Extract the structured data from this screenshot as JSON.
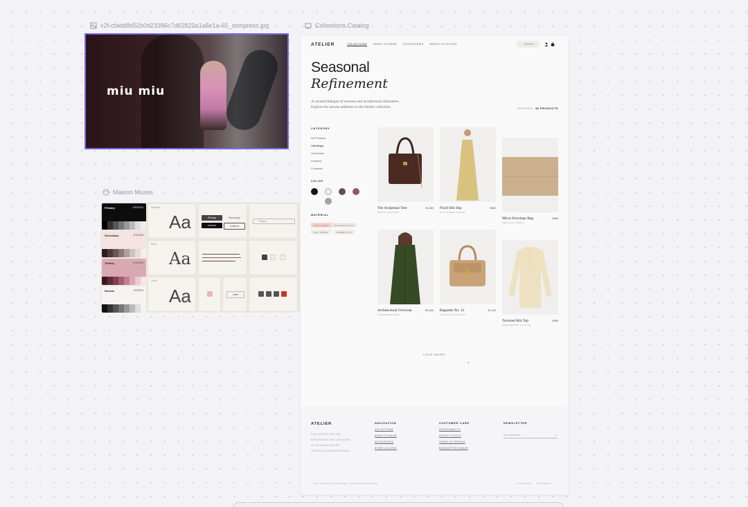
{
  "canvas": {
    "image_label": "v2f-cfadd8d52b0d23386c7d62823a1a5e1a-65_compress.jpg",
    "catalog_label": "Collections.Catalog",
    "muses_label": "Maison Muses"
  },
  "hero_image": {
    "logo_text": "miu miu"
  },
  "muses": {
    "swatches": [
      {
        "name": "Primary",
        "hex": "#0D0D0D",
        "color": "#0d0d0d",
        "ramp": [
          "#000",
          "#333",
          "#555",
          "#777",
          "#999",
          "#bbb",
          "#ddd",
          "#eee"
        ]
      },
      {
        "name": "Secondary",
        "hex": "#F5E6E8",
        "color": "#f3e4e0",
        "ramp": [
          "#2b1d1b",
          "#4e3936",
          "#6b5753",
          "#8d7a77",
          "#b09f9c",
          "#cfc1be",
          "#e5dbd8",
          "#f5efed"
        ]
      },
      {
        "name": "Tertiary",
        "hex": "#D4A5A5",
        "color": "#d9a9b1",
        "ramp": [
          "#3a1823",
          "#5e2d3d",
          "#823f55",
          "#a65c74",
          "#c18096",
          "#d9a7b6",
          "#ecc9d3",
          "#f7e5ea"
        ]
      },
      {
        "name": "Neutral",
        "hex": "#F8F8F8",
        "color": "#f6f4f2",
        "ramp": [
          "#111",
          "#333",
          "#555",
          "#777",
          "#999",
          "#bbb",
          "#ddd",
          "#f2f2f2"
        ]
      }
    ],
    "type_captions": [
      "Headline",
      "Body",
      "Label"
    ],
    "aa": "Aa",
    "buttons": {
      "primary": "Primary",
      "secondary": "Secondary",
      "inverse": "Inverse",
      "outlined": "Outlined",
      "label": "Label"
    },
    "search_placeholder": "Search"
  },
  "catalog": {
    "brand": "ATELIER",
    "nav": [
      "COLLECTIONS",
      "READY-TO-WEAR",
      "ACCESSORIES",
      "WORLD OF ATELIER"
    ],
    "search_label": "SEARCH",
    "hero_line1": "Seasonal",
    "hero_line2": "Refinement",
    "hero_sub1": "A curated dialogue of textures and architectural silhouettes.",
    "hero_sub2": "Explore the newest additions to the Atelier collection.",
    "showing_label": "SHOWING",
    "showing_count": "48 PRODUCTS",
    "filters": {
      "category_head": "CATEGORY",
      "categories": [
        "All Products",
        "Handbags",
        "Outerwear",
        "Knitwear",
        "Footwear"
      ],
      "color_head": "COLOR",
      "colors": [
        "#151515",
        "#efeeec",
        "#6b4f49",
        "#8b5a5f",
        "#a3a3a3"
      ],
      "material_head": "MATERIAL",
      "materials": [
        "SOFT NAPPA",
        "BRUSHED WOOL",
        "SILK CREPE",
        "RIBBED KNIT"
      ]
    },
    "products": [
      {
        "name": "The Sculptural Tote",
        "price": "€1,850",
        "material": "NAPPA LEATHER",
        "kind": "tote"
      },
      {
        "name": "Fluid Silk Slip",
        "price": "€820",
        "material": "SILK SHEEN CREPE",
        "kind": "dress"
      },
      {
        "name": "Micro Envelope Bag",
        "price": "€680",
        "material": "METALLIC NAPPA",
        "kind": "envelope"
      },
      {
        "name": "Architectural Overcoat",
        "price": "€2,400",
        "material": "CASHMERE WOOL",
        "kind": "coat"
      },
      {
        "name": "Baguette No. 12",
        "price": "€1,100",
        "material": "CALFSKIN LEATHER",
        "kind": "baguette"
      },
      {
        "name": "Textured Rib Top",
        "price": "€550",
        "material": "MERCERIZED COTTON",
        "kind": "top"
      }
    ],
    "load_more": "LOAD MORE",
    "footer": {
      "brand": "ATELIER",
      "tagline": [
        "THE DIGITAL ATELIER",
        "REDEFINING THE LANGUAGE",
        "OF MODERN LUXURY",
        "THROUGH CURATED DESIGN"
      ],
      "nav_head": "NAVIGATION",
      "nav_links": [
        "COLLECTIONS",
        "READY-TO-WEAR",
        "ACCESSORIES",
        "STORE LOCATOR"
      ],
      "care_head": "CUSTOMER CARE",
      "care_links": [
        "SUSTAINABILITY",
        "PRIVACY POLICY",
        "TERMS OF SERVICE",
        "NEWSLETTER SIGNUP"
      ],
      "news_head": "NEWSLETTER",
      "email_placeholder": "EMAIL ADDRESS",
      "copyright": "© 2024 THE DIGITAL ATELIER. ALL RIGHTS RESERVED.",
      "bottom_links": [
        "INSTAGRAM",
        "PINTEREST",
        "X"
      ]
    }
  }
}
